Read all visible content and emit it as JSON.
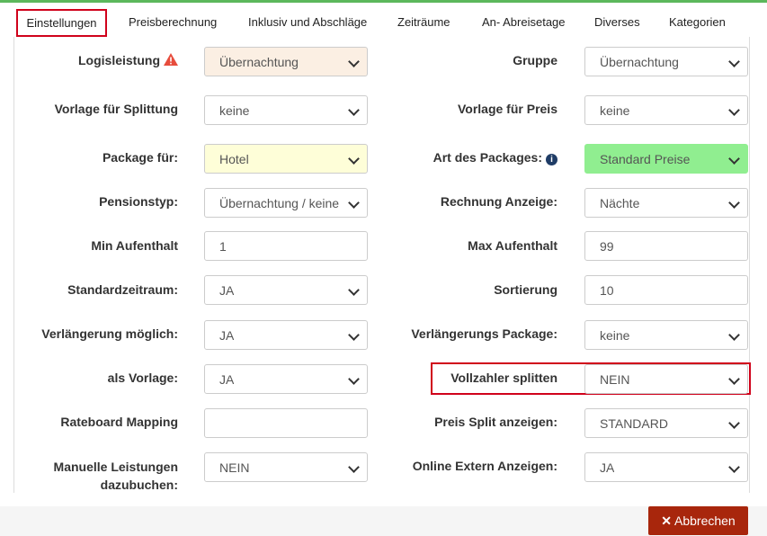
{
  "tabs": [
    "Einstellungen",
    "Preisberechnung",
    "Inklusiv und Abschläge",
    "Zeiträume",
    "An- Abreisetage",
    "Diverses",
    "Kategorien"
  ],
  "fields": {
    "logisleistung": {
      "label": "Logisleistung",
      "value": "Übernachtung"
    },
    "gruppe": {
      "label": "Gruppe",
      "value": "Übernachtung"
    },
    "vorlage_splittung": {
      "label": "Vorlage für Splittung",
      "value": "keine"
    },
    "vorlage_preis": {
      "label": "Vorlage für Preis",
      "value": "keine"
    },
    "package_fuer": {
      "label": "Package für:",
      "value": "Hotel"
    },
    "art_packages": {
      "label": "Art des Packages:",
      "value": "Standard Preise"
    },
    "pensionstyp": {
      "label": "Pensionstyp:",
      "value": "Übernachtung / keine"
    },
    "rechnung_anzeige": {
      "label": "Rechnung Anzeige:",
      "value": "Nächte"
    },
    "min_aufenthalt": {
      "label": "Min Aufenthalt",
      "value": "1"
    },
    "max_aufenthalt": {
      "label": "Max Aufenthalt",
      "value": "99"
    },
    "standardzeitraum": {
      "label": "Standardzeitraum:",
      "value": "JA"
    },
    "sortierung": {
      "label": "Sortierung",
      "value": "10"
    },
    "verlaengerung_moeglich": {
      "label": "Verlängerung möglich:",
      "value": "JA"
    },
    "verlaengerungs_package": {
      "label": "Verlängerungs Package:",
      "value": "keine"
    },
    "als_vorlage": {
      "label": "als Vorlage:",
      "value": "JA"
    },
    "vollzahler_splitten": {
      "label": "Vollzahler splitten",
      "value": "NEIN"
    },
    "rateboard_mapping": {
      "label": "Rateboard Mapping",
      "value": ""
    },
    "preis_split": {
      "label": "Preis Split anzeigen:",
      "value": "STANDARD"
    },
    "manuelle_leistungen": {
      "label": "Manuelle Leistungen dazubuchen:",
      "value": "NEIN"
    },
    "online_extern": {
      "label": "Online Extern Anzeigen:",
      "value": "JA"
    }
  },
  "footer": {
    "cancel_label": "Abbrechen"
  },
  "colors": {
    "accent_green": "#5cb85c",
    "danger": "#a8260c",
    "highlight": "#d0021b",
    "warning": "#e74c3c",
    "info": "#1f3c66"
  }
}
